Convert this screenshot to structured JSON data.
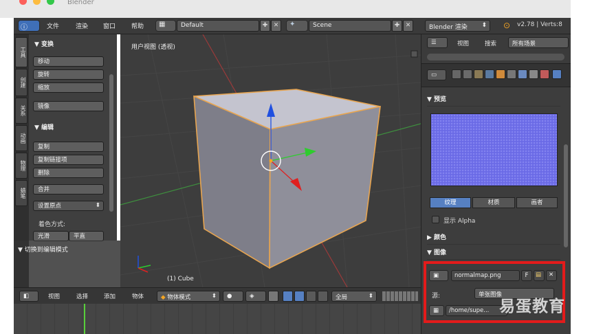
{
  "window": {
    "title": "Blender"
  },
  "topbar": {
    "menus": [
      "文件",
      "渲染",
      "窗口",
      "帮助"
    ],
    "layout": "Default",
    "scene": "Scene",
    "engine": "Blender 渲染",
    "version": "v2.78 | Verts:8"
  },
  "tool_shelf": {
    "tabs": [
      "工具",
      "创建",
      "关系",
      "动画",
      "物理",
      "蜡笔"
    ],
    "transform": {
      "header": "▼ 变换",
      "buttons": [
        "移动",
        "旋转",
        "缩放",
        "镜像"
      ]
    },
    "edit": {
      "header": "▼ 编辑",
      "buttons": [
        "复制",
        "复制链接项",
        "删除",
        "合并"
      ],
      "origin": "设置原点"
    },
    "shading_label": "着色方式:",
    "shading_buttons": [
      "光滑",
      "平直"
    ],
    "collapsed": "▼ 切换到编辑模式"
  },
  "viewport": {
    "label": "用户视图 (透视)",
    "object": "(1) Cube"
  },
  "viewport_header": {
    "menus": [
      "视图",
      "选择",
      "添加",
      "物体"
    ],
    "mode": "物体模式",
    "orientation": "全局"
  },
  "outliner": {
    "menus": [
      "视图",
      "搜索"
    ],
    "filter": "所有场景"
  },
  "properties": {
    "preview_header": "▼ 预览",
    "tabs": [
      "纹理",
      "材质",
      "画者"
    ],
    "active_tab": "纹理",
    "show_alpha": "显示 Alpha",
    "colors_header": "▶ 颜色",
    "image_header": "▼ 图像",
    "image_name": "normalmap.png",
    "image_fake": "F",
    "source_label": "源:",
    "source_value": "单张图像",
    "filepath": "/home/supe..."
  },
  "watermark": "易蛋教育",
  "colors": {
    "highlight_box": "#e31b1b",
    "active_tab": "#5680c2",
    "cube_outline": "#e8a550",
    "axis_x": "#e02020",
    "axis_y": "#2ecc2e",
    "axis_z": "#2050e0"
  }
}
